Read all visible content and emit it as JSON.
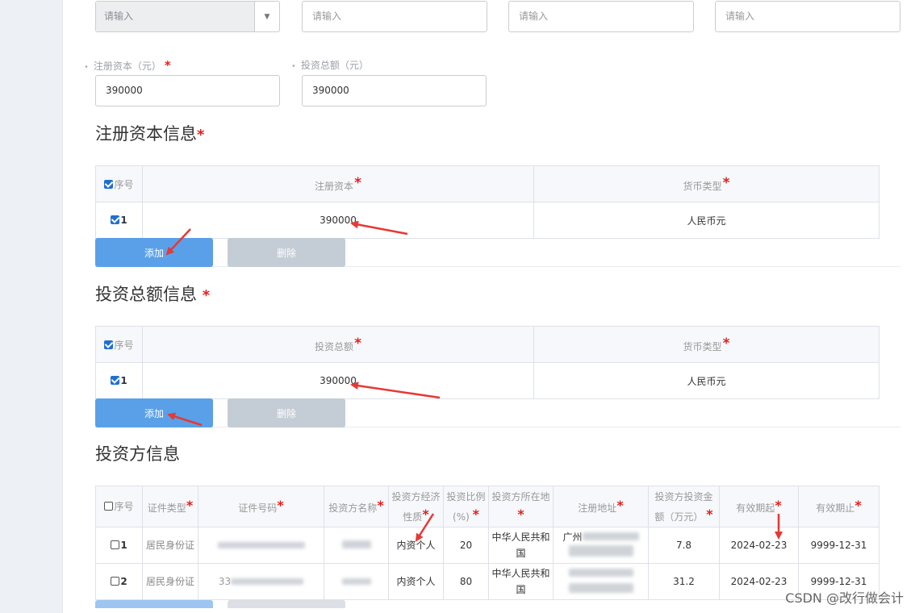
{
  "top_row": {
    "select_placeholder": "请输入",
    "input_placeholders": [
      "请输入",
      "请输入",
      "请输入"
    ]
  },
  "fields": {
    "registered_capital": {
      "label": "注册资本（元）",
      "value": "390000",
      "required": "*"
    },
    "total_investment": {
      "label": "投资总额（元）",
      "value": "390000"
    }
  },
  "registered_capital_section": {
    "title": "注册资本信息",
    "title_star": "*",
    "columns": [
      "序号",
      "注册资本",
      "货币类型"
    ],
    "rows": [
      {
        "index": "1",
        "amount": "390000",
        "currency": "人民币元"
      }
    ],
    "add_label": "添加",
    "delete_label": "删除"
  },
  "total_investment_section": {
    "title": "投资总额信息",
    "title_star": "*",
    "columns": [
      "序号",
      "投资总额",
      "货币类型"
    ],
    "rows": [
      {
        "index": "1",
        "amount": "390000",
        "currency": "人民币元"
      }
    ],
    "add_label": "添加",
    "delete_label": "删除"
  },
  "investor_section": {
    "title": "投资方信息",
    "columns": {
      "index": "序号",
      "id_type": "证件类型",
      "id_number": "证件号码",
      "investor_name": "投资方名称",
      "econ_nature_1": "投资方经济",
      "econ_nature_2": "性质",
      "ratio_1": "投资比例",
      "ratio_2": "(%)",
      "location_1": "投资方所在地",
      "reg_address": "注册地址",
      "amount_1": "投资方投资金",
      "amount_2": "额（万元）",
      "valid_from": "有效期起",
      "valid_to": "有效期止"
    },
    "rows": [
      {
        "index": "1",
        "id_type": "居民身份证",
        "econ_nature": "内资个人",
        "ratio": "20",
        "location_1": "中华人民共和",
        "location_2": "国",
        "address": "广州",
        "amount": "7.8",
        "valid_from": "2024-02-23",
        "valid_to": "9999-12-31"
      },
      {
        "index": "2",
        "id_type": "居民身份证",
        "id_number_partial": "33",
        "econ_nature": "内资个人",
        "ratio": "80",
        "location_1": "中华人民共和",
        "location_2": "国",
        "address": "",
        "amount": "31.2",
        "valid_from": "2024-02-23",
        "valid_to": "9999-12-31"
      }
    ]
  },
  "watermark": "CSDN @改行做会计",
  "colors": {
    "required_star": "#e02020",
    "add_button": "#5aa0e8",
    "delete_button": "#c4ccd5",
    "checkbox": "#1f6fd1",
    "annotation_arrow": "#e53935"
  }
}
